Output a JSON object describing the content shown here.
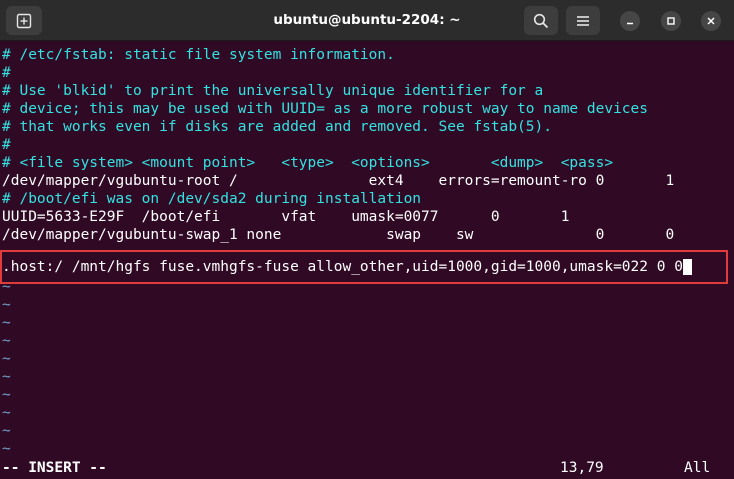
{
  "window": {
    "title": "ubuntu@ubuntu-2204: ~"
  },
  "icons": {
    "new_tab": "new-tab-icon",
    "search": "search-icon",
    "menu": "hamburger-menu-icon",
    "minimize": "minimize-icon",
    "maximize": "maximize-icon",
    "close": "close-icon"
  },
  "colors": {
    "background": "#300a24",
    "comment": "#34e2e2",
    "keyword": "#ad7fa8",
    "value": "#fce94f",
    "highlight_border": "#e03c3c"
  },
  "file": {
    "lines": [
      "# /etc/fstab: static file system information.",
      "#",
      "# Use 'blkid' to print the universally unique identifier for a",
      "# device; this may be used with UUID= as a more robust way to name devices",
      "# that works even if disks are added and removed. See fstab(5).",
      "#",
      "# <file system> <mount point>   <type>  <options>       <dump>  <pass>",
      "/dev/mapper/vgubuntu-root /               ext4    errors=remount-ro 0       1",
      "# /boot/efi was on /dev/sda2 during installation",
      "UUID=5633-E29F  /boot/efi       vfat    umask=0077      0       1",
      "/dev/mapper/vgubuntu-swap_1 none            swap    sw              0       0"
    ],
    "new_entry": ".host:/ /mnt/hgfs fuse.vmhgfs-fuse allow_other,uid=1000,gid=1000,umask=022 0 0"
  },
  "tildes": [
    "~",
    "~",
    "~",
    "~",
    "~",
    "~",
    "~",
    "~",
    "~",
    "~"
  ],
  "statusbar": {
    "mode": "-- INSERT --",
    "position": "13,79",
    "scroll": "All"
  }
}
